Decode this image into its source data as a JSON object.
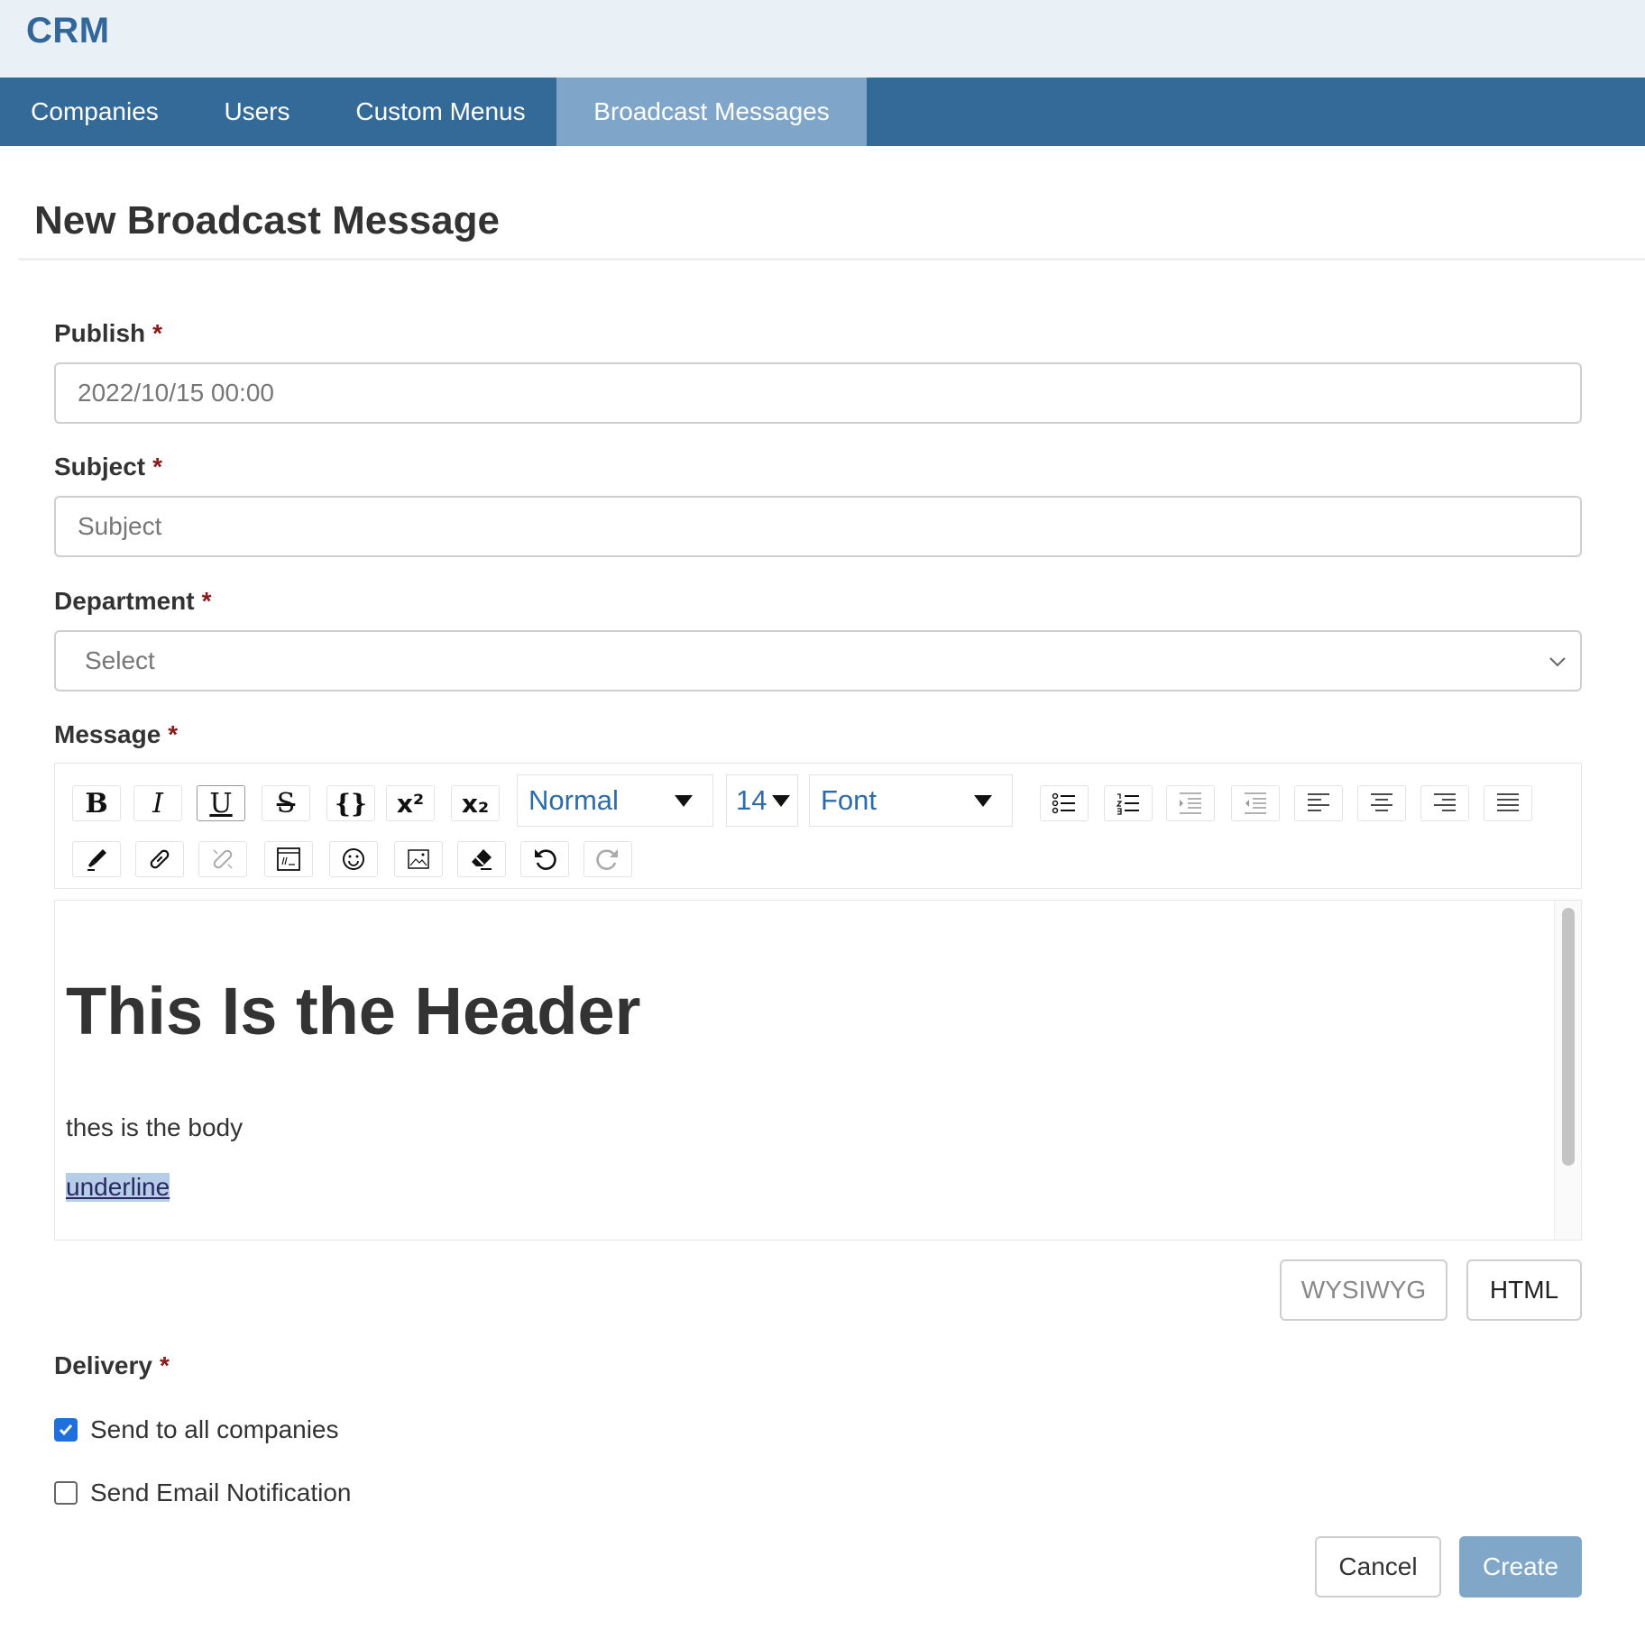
{
  "app": {
    "brand": "CRM"
  },
  "nav": {
    "tabs": [
      {
        "label": "Companies"
      },
      {
        "label": "Users"
      },
      {
        "label": "Custom Menus"
      },
      {
        "label": "Broadcast Messages",
        "active": true
      }
    ]
  },
  "page": {
    "title": "New Broadcast Message"
  },
  "form": {
    "publish": {
      "label": "Publish",
      "required_mark": "*",
      "value": "2022/10/15 00:00"
    },
    "subject": {
      "label": "Subject",
      "required_mark": "*",
      "placeholder": "Subject",
      "value": ""
    },
    "department": {
      "label": "Department",
      "required_mark": "*",
      "selected": "Select"
    },
    "message": {
      "label": "Message",
      "required_mark": "*",
      "toolbar": {
        "paragraph_style": "Normal",
        "font_size": "14",
        "font_name": "Font",
        "buttons_row1": [
          "bold-icon",
          "italic-icon",
          "underline-icon",
          "strikethrough-icon",
          "code-braces-icon",
          "superscript-icon",
          "subscript-icon",
          "bullet-list-icon",
          "numbered-list-icon",
          "indent-icon",
          "outdent-icon",
          "align-left-icon",
          "align-center-icon",
          "align-right-icon",
          "align-justify-icon"
        ],
        "buttons_row2": [
          "highlighter-icon",
          "link-icon",
          "unlink-icon",
          "embed-code-icon",
          "emoji-icon",
          "image-icon",
          "eraser-icon",
          "undo-icon",
          "redo-icon"
        ]
      },
      "content": {
        "header": "This Is the Header",
        "body": "thes is the body",
        "underline": "underline"
      }
    },
    "mode": {
      "wysiwyg": "WYSIWYG",
      "html": "HTML"
    },
    "delivery": {
      "label": "Delivery",
      "required_mark": "*",
      "options": [
        {
          "label": "Send to all companies",
          "checked": true
        },
        {
          "label": "Send Email Notification",
          "checked": false
        }
      ]
    },
    "actions": {
      "cancel": "Cancel",
      "create": "Create"
    }
  },
  "colors": {
    "nav_bg": "#346a98",
    "nav_active": "#7fa6c9",
    "brand": "#336699",
    "required": "#8b1a1a",
    "create_btn": "#80a6c8",
    "checkbox": "#1f6fdc"
  }
}
